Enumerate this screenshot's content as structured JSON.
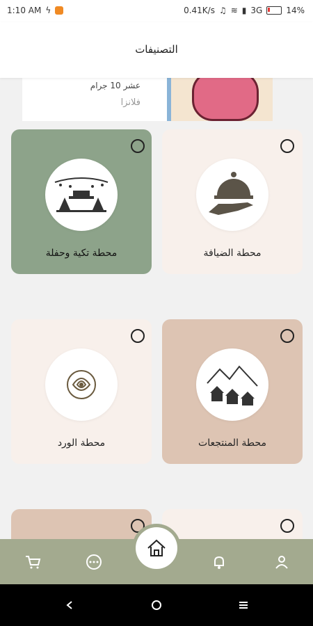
{
  "status_bar": {
    "time": "1:10 AM",
    "speed": "0.41K/s",
    "network": "3G",
    "battery": "14%"
  },
  "header": {
    "title": "التصنيفات"
  },
  "banner": {
    "line1": "عشر 10 جرام",
    "line2": "فلانزا"
  },
  "categories": [
    {
      "label": "محطة الضيافة",
      "bg": "#f8f0eb",
      "icon": "food-cloche-icon"
    },
    {
      "label": "محطة تكية وحفلة",
      "bg": "#8da38a",
      "icon": "party-tent-icon"
    },
    {
      "label": "محطة المنتجعات",
      "bg": "#ddc4b3",
      "icon": "chalets-icon"
    },
    {
      "label": "محطة الورد",
      "bg": "#f8f0eb",
      "icon": "rose-icon"
    }
  ],
  "bottom_nav": {
    "items": [
      "profile-icon",
      "bell-icon",
      "home-icon",
      "chat-icon",
      "cart-icon"
    ],
    "bg": "#a3aa8f"
  }
}
